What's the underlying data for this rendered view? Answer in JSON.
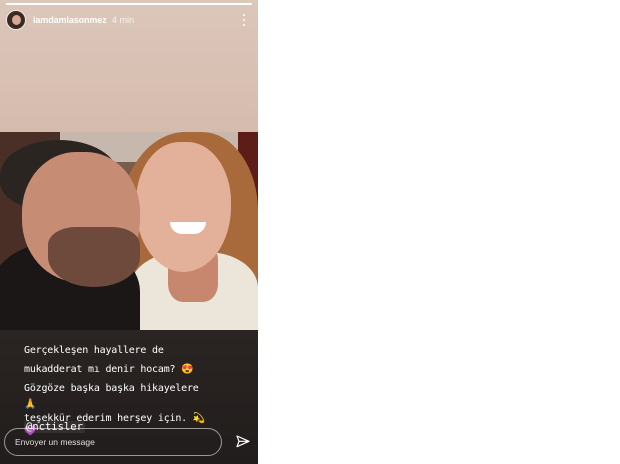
{
  "story": {
    "progress": 1.0,
    "header": {
      "username": "iamdamlasonmez",
      "time": "4 min",
      "avatar_icon": "profile-avatar",
      "more_icon": "vertical-ellipsis-icon"
    },
    "caption": {
      "lines": [
        "Gerçekleşen hayallere de",
        "mukadderat mı denir hocam? 😍",
        "Gözgöze başka başka hikayelere",
        "🙏",
        "teşekkür ederim herşey için. 💫",
        "💜"
      ],
      "mention": "@nctisler"
    },
    "reply": {
      "placeholder": "Envoyer un message",
      "send_icon": "paper-plane-icon"
    }
  }
}
